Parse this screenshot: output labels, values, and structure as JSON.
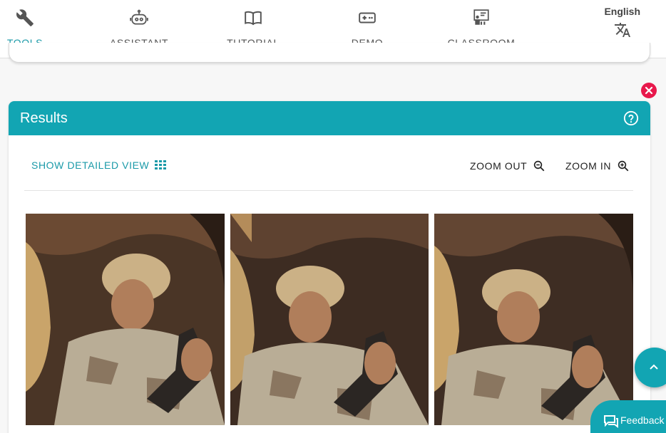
{
  "nav": {
    "items": [
      {
        "label": "TOOLS",
        "icon": "wrench-icon",
        "active": true
      },
      {
        "label": "ASSISTANT",
        "icon": "robot-icon",
        "active": false
      },
      {
        "label": "TUTORIAL",
        "icon": "book-icon",
        "active": false
      },
      {
        "label": "DEMO",
        "icon": "gamepad-icon",
        "active": false
      },
      {
        "label": "CLASSROOM",
        "icon": "classroom-icon",
        "active": false
      }
    ],
    "language": "English",
    "language_icon": "translate-icon"
  },
  "results": {
    "title": "Results",
    "help_icon": "help-circle-icon",
    "close_icon": "close-icon",
    "show_detailed_label": "SHOW DETAILED VIEW",
    "zoom_out_label": "ZOOM OUT",
    "zoom_in_label": "ZOOM IN",
    "frames_count": 3
  },
  "scroll_top_icon": "chevron-up-icon",
  "feedback_label": "Feedback",
  "colors": {
    "accent": "#12a5b3",
    "close": "#e8194c"
  }
}
